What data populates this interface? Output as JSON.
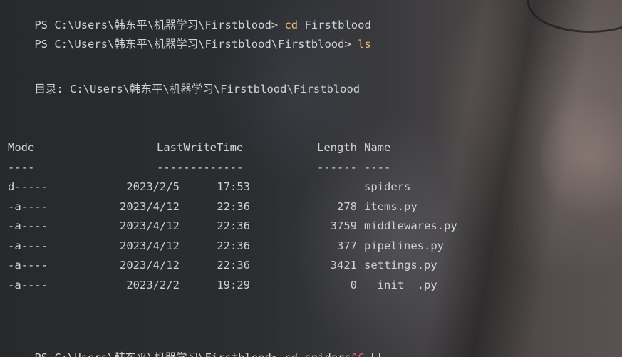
{
  "terminal": {
    "line1": {
      "prompt": "PS C:\\Users\\韩东平\\机器学习\\Firstblood>",
      "command": "cd",
      "arg": "Firstblood"
    },
    "line2": {
      "prompt": "PS C:\\Users\\韩东平\\机器学习\\Firstblood\\Firstblood>",
      "command": "ls"
    },
    "directory_line": "    目录: C:\\Users\\韩东平\\机器学习\\Firstblood\\Firstblood",
    "headers": {
      "mode": "Mode",
      "time": "LastWriteTime",
      "length": "Length",
      "name": "Name"
    },
    "separators": {
      "mode": "----",
      "time": "-------------",
      "length": "------",
      "name": "----"
    },
    "rows": [
      {
        "mode": "d-----",
        "date": "2023/2/5",
        "time": "17:53",
        "length": "",
        "name": "spiders"
      },
      {
        "mode": "-a----",
        "date": "2023/4/12",
        "time": "22:36",
        "length": "278",
        "name": "items.py"
      },
      {
        "mode": "-a----",
        "date": "2023/4/12",
        "time": "22:36",
        "length": "3759",
        "name": "middlewares.py"
      },
      {
        "mode": "-a----",
        "date": "2023/4/12",
        "time": "22:36",
        "length": "377",
        "name": "pipelines.py"
      },
      {
        "mode": "-a----",
        "date": "2023/4/12",
        "time": "22:36",
        "length": "3421",
        "name": "settings.py"
      },
      {
        "mode": "-a----",
        "date": "2023/2/2",
        "time": "19:29",
        "length": "0",
        "name": "__init__.py"
      }
    ],
    "line_last": {
      "prompt": "PS C:\\Users\\韩东平\\机器学习\\Firstblood>",
      "command": "cd",
      "arg": "spiders",
      "ctrl": "^C"
    }
  },
  "colors": {
    "text": "#d0d2d6",
    "command": "#e7b96f",
    "interrupt": "#e0646c"
  }
}
